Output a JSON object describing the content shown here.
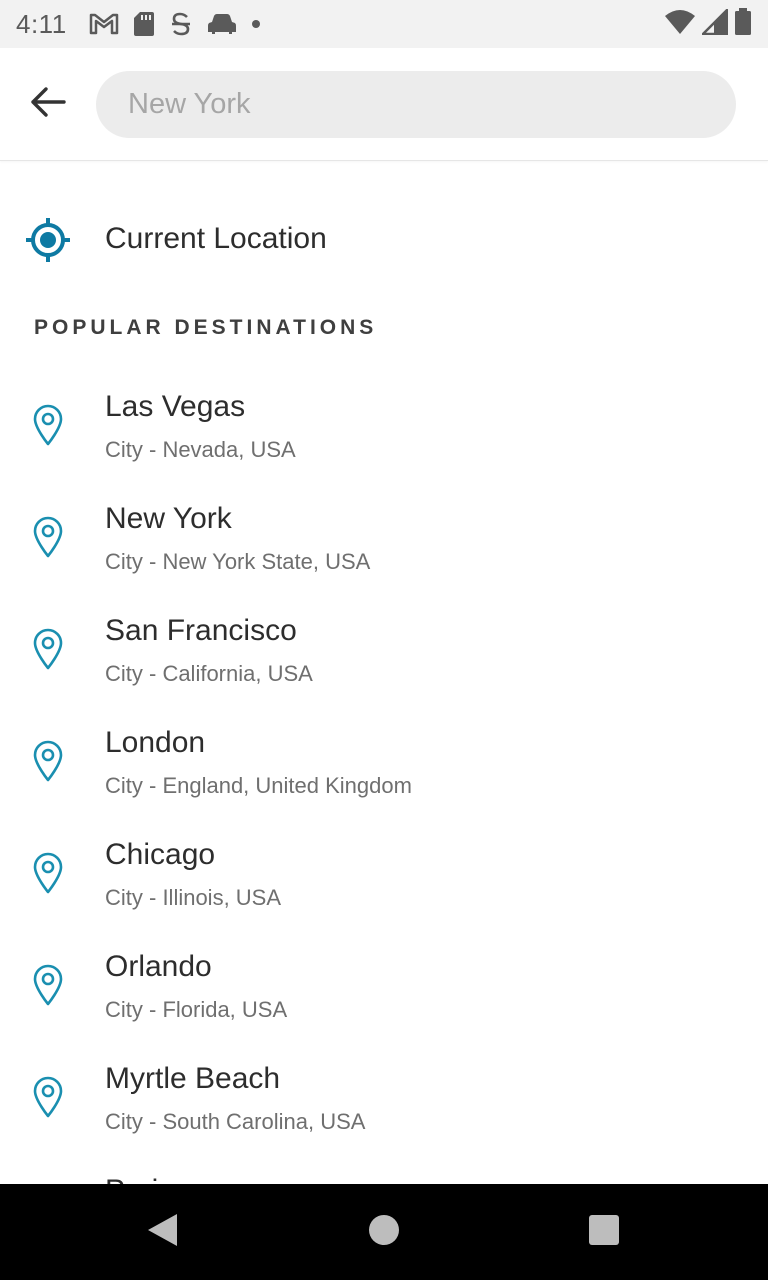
{
  "status_bar": {
    "time": "4:11",
    "left_icons": [
      "gmail-icon",
      "sd-card-icon",
      "sync-icon",
      "car-icon",
      "dot-icon"
    ],
    "right_icons": [
      "wifi-icon",
      "signal-icon",
      "battery-icon"
    ]
  },
  "header": {
    "back_icon": "arrow-left-icon",
    "search_placeholder": "New York"
  },
  "current_location": {
    "label": "Current Location",
    "icon": "gps-target-icon"
  },
  "section_title": "POPULAR DESTINATIONS",
  "destinations": [
    {
      "name": "Las Vegas",
      "subtitle": "City - Nevada, USA"
    },
    {
      "name": "New York",
      "subtitle": "City - New York State, USA"
    },
    {
      "name": "San Francisco",
      "subtitle": "City - California, USA"
    },
    {
      "name": "London",
      "subtitle": "City - England, United Kingdom"
    },
    {
      "name": "Chicago",
      "subtitle": "City - Illinois, USA"
    },
    {
      "name": "Orlando",
      "subtitle": "City - Florida, USA"
    },
    {
      "name": "Myrtle Beach",
      "subtitle": "City - South Carolina, USA"
    },
    {
      "name": "Paris",
      "subtitle": ""
    }
  ],
  "colors": {
    "accent": "#0e7aa3",
    "pin": "#1a8fb0"
  },
  "nav_bar": {
    "icons": [
      "back-triangle-icon",
      "home-circle-icon",
      "recents-square-icon"
    ]
  }
}
